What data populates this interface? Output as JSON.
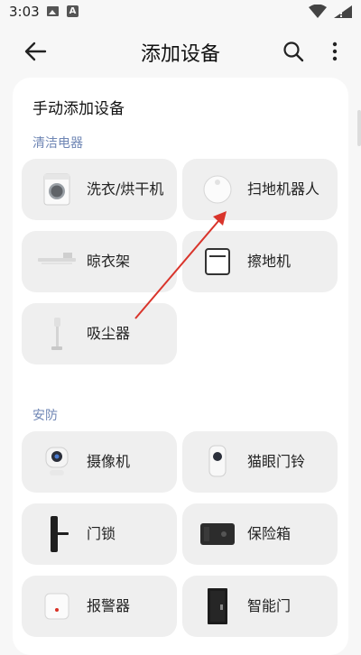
{
  "status_bar": {
    "time": "3:03",
    "icons": [
      "image-icon",
      "a-icon",
      "wifi-icon",
      "battery-icon"
    ]
  },
  "toolbar": {
    "title": "添加设备",
    "icons": [
      "back-icon",
      "search-icon",
      "more-icon"
    ]
  },
  "content": {
    "card_title": "手动添加设备",
    "sections": [
      {
        "label": "清洁电器",
        "devices": [
          {
            "name": "洗衣/烘干机",
            "icon": "washer-icon"
          },
          {
            "name": "扫地机器人",
            "icon": "robot-vacuum-icon"
          },
          {
            "name": "晾衣架",
            "icon": "clothes-rack-icon"
          },
          {
            "name": "擦地机",
            "icon": "floor-scrubber-icon"
          },
          {
            "name": "吸尘器",
            "icon": "vacuum-icon"
          }
        ]
      },
      {
        "label": "安防",
        "devices": [
          {
            "name": "摄像机",
            "icon": "camera-icon"
          },
          {
            "name": "猫眼门铃",
            "icon": "doorbell-icon"
          },
          {
            "name": "门锁",
            "icon": "door-lock-icon"
          },
          {
            "name": "保险箱",
            "icon": "safe-icon"
          },
          {
            "name": "报警器",
            "icon": "alarm-icon"
          },
          {
            "name": "智能门",
            "icon": "smart-door-icon"
          }
        ]
      }
    ]
  },
  "colors": {
    "background": "#f7f7f7",
    "card": "#ffffff",
    "tile": "#efefef",
    "section_label": "#6f86b4",
    "annotation_arrow": "#d9342b"
  }
}
